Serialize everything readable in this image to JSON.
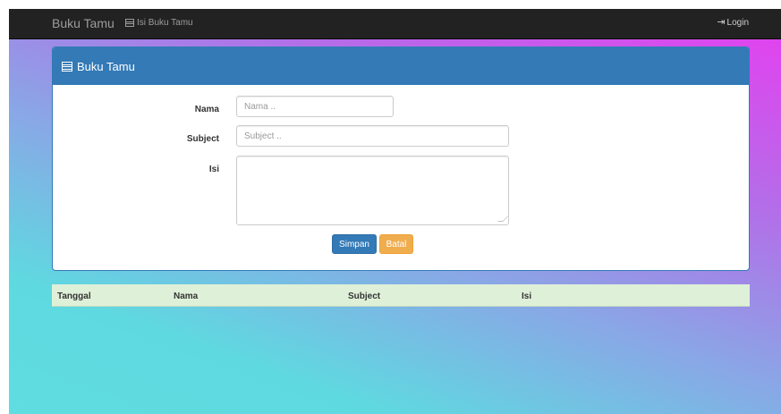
{
  "navbar": {
    "brand": "Buku Tamu",
    "nav_link": "Isi Buku Tamu",
    "login": "Login"
  },
  "panel": {
    "title": "Buku Tamu"
  },
  "form": {
    "nama_label": "Nama",
    "nama_placeholder": "Nama ..",
    "nama_value": "",
    "subject_label": "Subject",
    "subject_placeholder": "Subject ..",
    "subject_value": "",
    "isi_label": "Isi",
    "isi_value": "",
    "save_label": "Simpan",
    "cancel_label": "Batal"
  },
  "table": {
    "columns": [
      "Tanggal",
      "Nama",
      "Subject",
      "Isi"
    ],
    "rows": []
  },
  "colors": {
    "primary": "#337ab7",
    "warning": "#f0ad4e",
    "navbar": "#222222",
    "table_header": "#dff0d8"
  },
  "icons": {
    "nav_link": "table-icon",
    "panel_title": "table-icon",
    "login": "login-icon"
  }
}
